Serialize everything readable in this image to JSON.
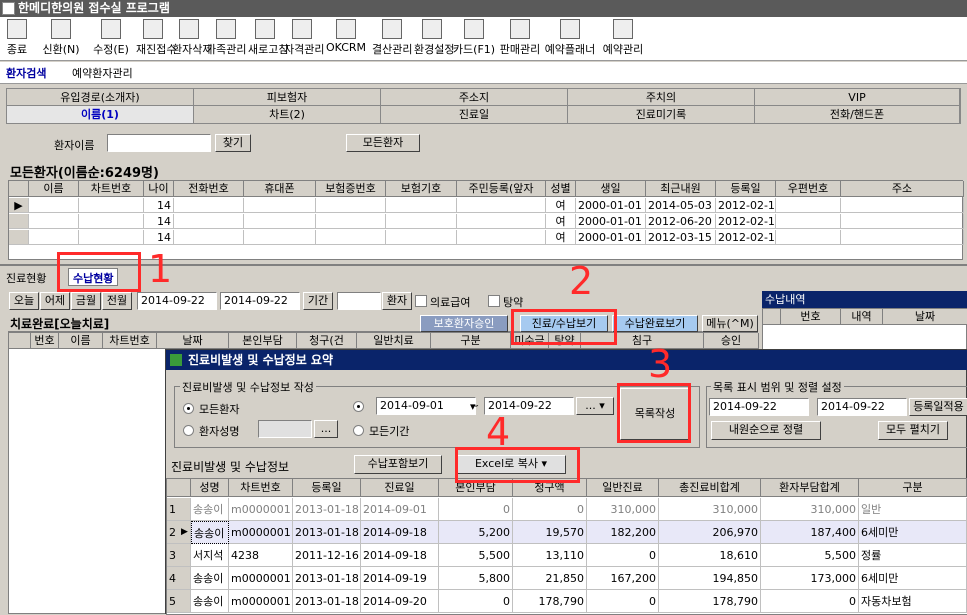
{
  "app": {
    "title": "한메디한의원 접수실 프로그램"
  },
  "toolbar": [
    {
      "label": "종료",
      "icon": "exit-icon"
    },
    {
      "label": "신환(N)",
      "icon": "new-patient-icon"
    },
    {
      "label": "수정(E)",
      "icon": "edit-icon"
    },
    {
      "label": "재진접수",
      "icon": "revisit-icon"
    },
    {
      "label": "환자삭제",
      "icon": "delete-patient-icon"
    },
    {
      "label": "가족관리",
      "icon": "family-icon"
    },
    {
      "label": "새로고침",
      "icon": "refresh-icon"
    },
    {
      "label": "자격관리",
      "icon": "qualification-icon"
    },
    {
      "label": "OKCRM",
      "icon": "crm-icon"
    },
    {
      "label": "결산관리",
      "icon": "settlement-icon"
    },
    {
      "label": "환경설정",
      "icon": "settings-icon"
    },
    {
      "label": "카드(F1)",
      "icon": "card-icon"
    },
    {
      "label": "판매관리",
      "icon": "sales-icon"
    },
    {
      "label": "예약플래너",
      "icon": "planner-icon"
    },
    {
      "label": "예약관리",
      "icon": "calendar-icon"
    }
  ],
  "tabs": {
    "patient_search": "환자검색",
    "reservation_mgmt": "예약환자관리"
  },
  "search_header": {
    "row1": [
      "유입경로(소개자)",
      "피보험자",
      "주소지",
      "주치의",
      "VIP"
    ],
    "row2": [
      "이름(1)",
      "차트(2)",
      "진료일",
      "진료미기록",
      "전화/핸드폰"
    ]
  },
  "search": {
    "name_label": "환자이름",
    "find_button": "찾기",
    "all_button": "모든환자"
  },
  "patient_list": {
    "title": "모든환자(이름순:6249명)",
    "columns": [
      "이름",
      "차트번호",
      "나이",
      "전화번호",
      "휴대폰",
      "보험증번호",
      "보험기호",
      "주민등록(앞자",
      "성별",
      "생일",
      "최근내원",
      "등록일",
      "우편번호",
      "주소"
    ],
    "rows": [
      {
        "name": "",
        "chart": "",
        "age": "14",
        "sex": "여",
        "birth": "2000-01-01",
        "last": "2014-05-03",
        "reg": "2012-02-15"
      },
      {
        "name": "",
        "chart": "",
        "age": "14",
        "sex": "여",
        "birth": "2000-01-01",
        "last": "2012-06-20",
        "reg": "2012-02-15"
      },
      {
        "name": "",
        "chart": "",
        "age": "14",
        "sex": "여",
        "birth": "2000-01-01",
        "last": "2012-03-15",
        "reg": "2012-02-15"
      }
    ]
  },
  "lower_tabs": {
    "treatment_status": "진료현황",
    "payment_status": "수납현황"
  },
  "filter": {
    "today": "오늘",
    "yesterday": "어제",
    "this_month": "금월",
    "last_month": "전월",
    "date_from": "2014-09-22",
    "date_to": "2014-09-22",
    "period": "기간",
    "patient": "환자",
    "medical_aid": "의료급여",
    "herbal": "탕약"
  },
  "treatment_done": {
    "title": "치료완료[오늘치료]",
    "guardian_btn": "보호환자승인",
    "treat_pay_btn": "진료/수납보기",
    "pay_done_btn": "수납완료보기",
    "menu_btn": "메뉴(^M)",
    "columns": [
      "번호",
      "이름",
      "차트번호",
      "날짜",
      "본인부담",
      "청구(건",
      "일반치료",
      "구분",
      "미수금",
      "탕약",
      "침구",
      "승인"
    ]
  },
  "payment_detail": {
    "title": "수납내역",
    "columns": [
      "번호",
      "내역",
      "날짜"
    ]
  },
  "dialog": {
    "title": "진료비발생 및 수납정보 요약",
    "create_group": "진료비발생 및 수납정보 작성",
    "all_patients": "모든환자",
    "patient_name": "환자성명",
    "date_from": "2014-09-01",
    "date_to": "2014-09-22",
    "all_period": "모든기간",
    "make_list": "목록작성",
    "range_group": "목록 표시 범위 및 정렬 설정",
    "range_from": "2014-09-22",
    "range_to": "2014-09-22",
    "sort_dropdown": "등록일적용",
    "sort_btn": "내원순으로 정렬",
    "expand_all": "모두 펼치기",
    "section_title": "진료비발생 및 수납정보",
    "include_pay": "수납포함보기",
    "excel_copy": "Excel로 복사",
    "columns": [
      "성명",
      "차트번호",
      "등록일",
      "진료일",
      "본인부담",
      "청구액",
      "일반진료",
      "총진료비합계",
      "환자부담합계",
      "구분"
    ],
    "rows": [
      {
        "no": "1",
        "name": "송송이",
        "chart": "m0000001",
        "reg": "2013-01-18",
        "visit": "2014-09-01",
        "self": "0",
        "claim": "0",
        "general": "310,000",
        "total": "310,000",
        "patient_total": "310,000",
        "type": "일반"
      },
      {
        "no": "2",
        "name": "송송이",
        "chart": "m0000001",
        "reg": "2013-01-18",
        "visit": "2014-09-18",
        "self": "5,200",
        "claim": "19,570",
        "general": "182,200",
        "total": "206,970",
        "patient_total": "187,400",
        "type": "6세미만"
      },
      {
        "no": "3",
        "name": "서지석",
        "chart": "4238",
        "reg": "2011-12-16",
        "visit": "2014-09-18",
        "self": "5,500",
        "claim": "13,110",
        "general": "0",
        "total": "18,610",
        "patient_total": "5,500",
        "type": "정률"
      },
      {
        "no": "4",
        "name": "송송이",
        "chart": "m0000001",
        "reg": "2013-01-18",
        "visit": "2014-09-19",
        "self": "5,800",
        "claim": "21,850",
        "general": "167,200",
        "total": "194,850",
        "patient_total": "173,000",
        "type": "6세미만"
      },
      {
        "no": "5",
        "name": "송송이",
        "chart": "m0000001",
        "reg": "2013-01-18",
        "visit": "2014-09-20",
        "self": "0",
        "claim": "178,790",
        "general": "0",
        "total": "178,790",
        "patient_total": "0",
        "type": "자동차보험"
      }
    ]
  },
  "annotations": [
    "1",
    "2",
    "3",
    "4"
  ]
}
